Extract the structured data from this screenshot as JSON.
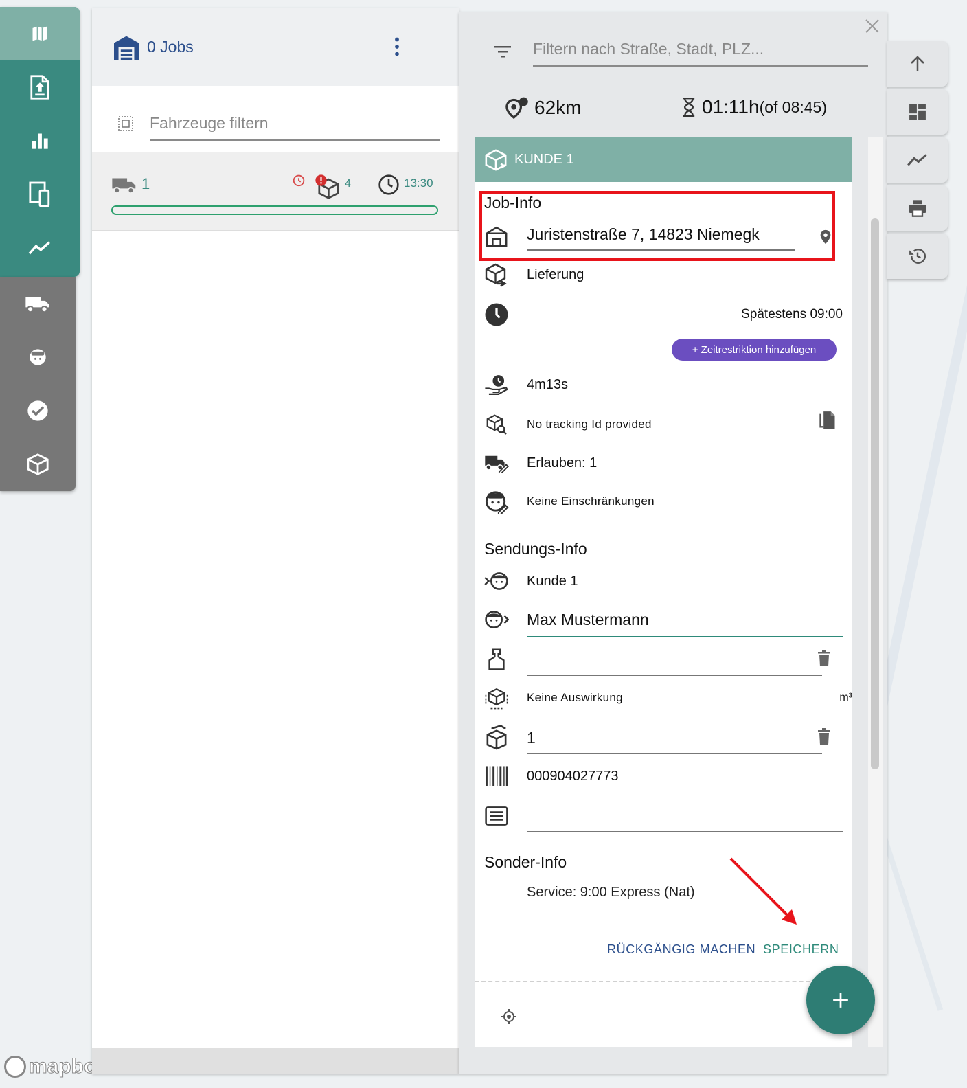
{
  "vehicles_panel": {
    "jobs_count": "0 Jobs",
    "filter_placeholder": "Fahrzeuge filtern",
    "vehicle": {
      "number": "1",
      "package_count": "4",
      "time": "13:30",
      "progress": 1.0
    }
  },
  "detail_panel": {
    "filter_placeholder": "Filtern nach Straße, Stadt, PLZ...",
    "distance": "62km",
    "duration": "01:11h",
    "duration_of": "(of 08:45)",
    "card_title": "KUNDE 1",
    "job_info": {
      "heading": "Job-Info",
      "address": "Juristenstraße 7, 14823 Niemegk",
      "type": "Lieferung",
      "time_window": "Spätestens 09:00",
      "add_time_restriction": "+ Zeitrestriktion hinzufügen",
      "service_time": "4m13s",
      "tracking": "No tracking Id provided",
      "vehicles_allowed": "Erlauben: 1",
      "driver_restrictions": "Keine Einschränkungen"
    },
    "shipment_info": {
      "heading": "Sendungs-Info",
      "sender": "Kunde 1",
      "recipient": "Max Mustermann",
      "weight": "",
      "volume": "Keine Auswirkung",
      "volume_unit": "m³",
      "packages": "1",
      "barcode": "000904027773",
      "notes": ""
    },
    "special_info": {
      "heading": "Sonder-Info",
      "service": "Service: 9:00 Express (Nat)"
    },
    "undo_label": "RÜCKGÄNGIG MACHEN",
    "save_label": "SPEICHERN"
  },
  "colors": {
    "nav_teal": "#3a8a80",
    "nav_gray": "#777777",
    "highlight_red": "#e8141b",
    "chip_purple": "#6b4ec0",
    "link_blue": "#2c4f8c"
  },
  "map_attribution": "mapbox"
}
